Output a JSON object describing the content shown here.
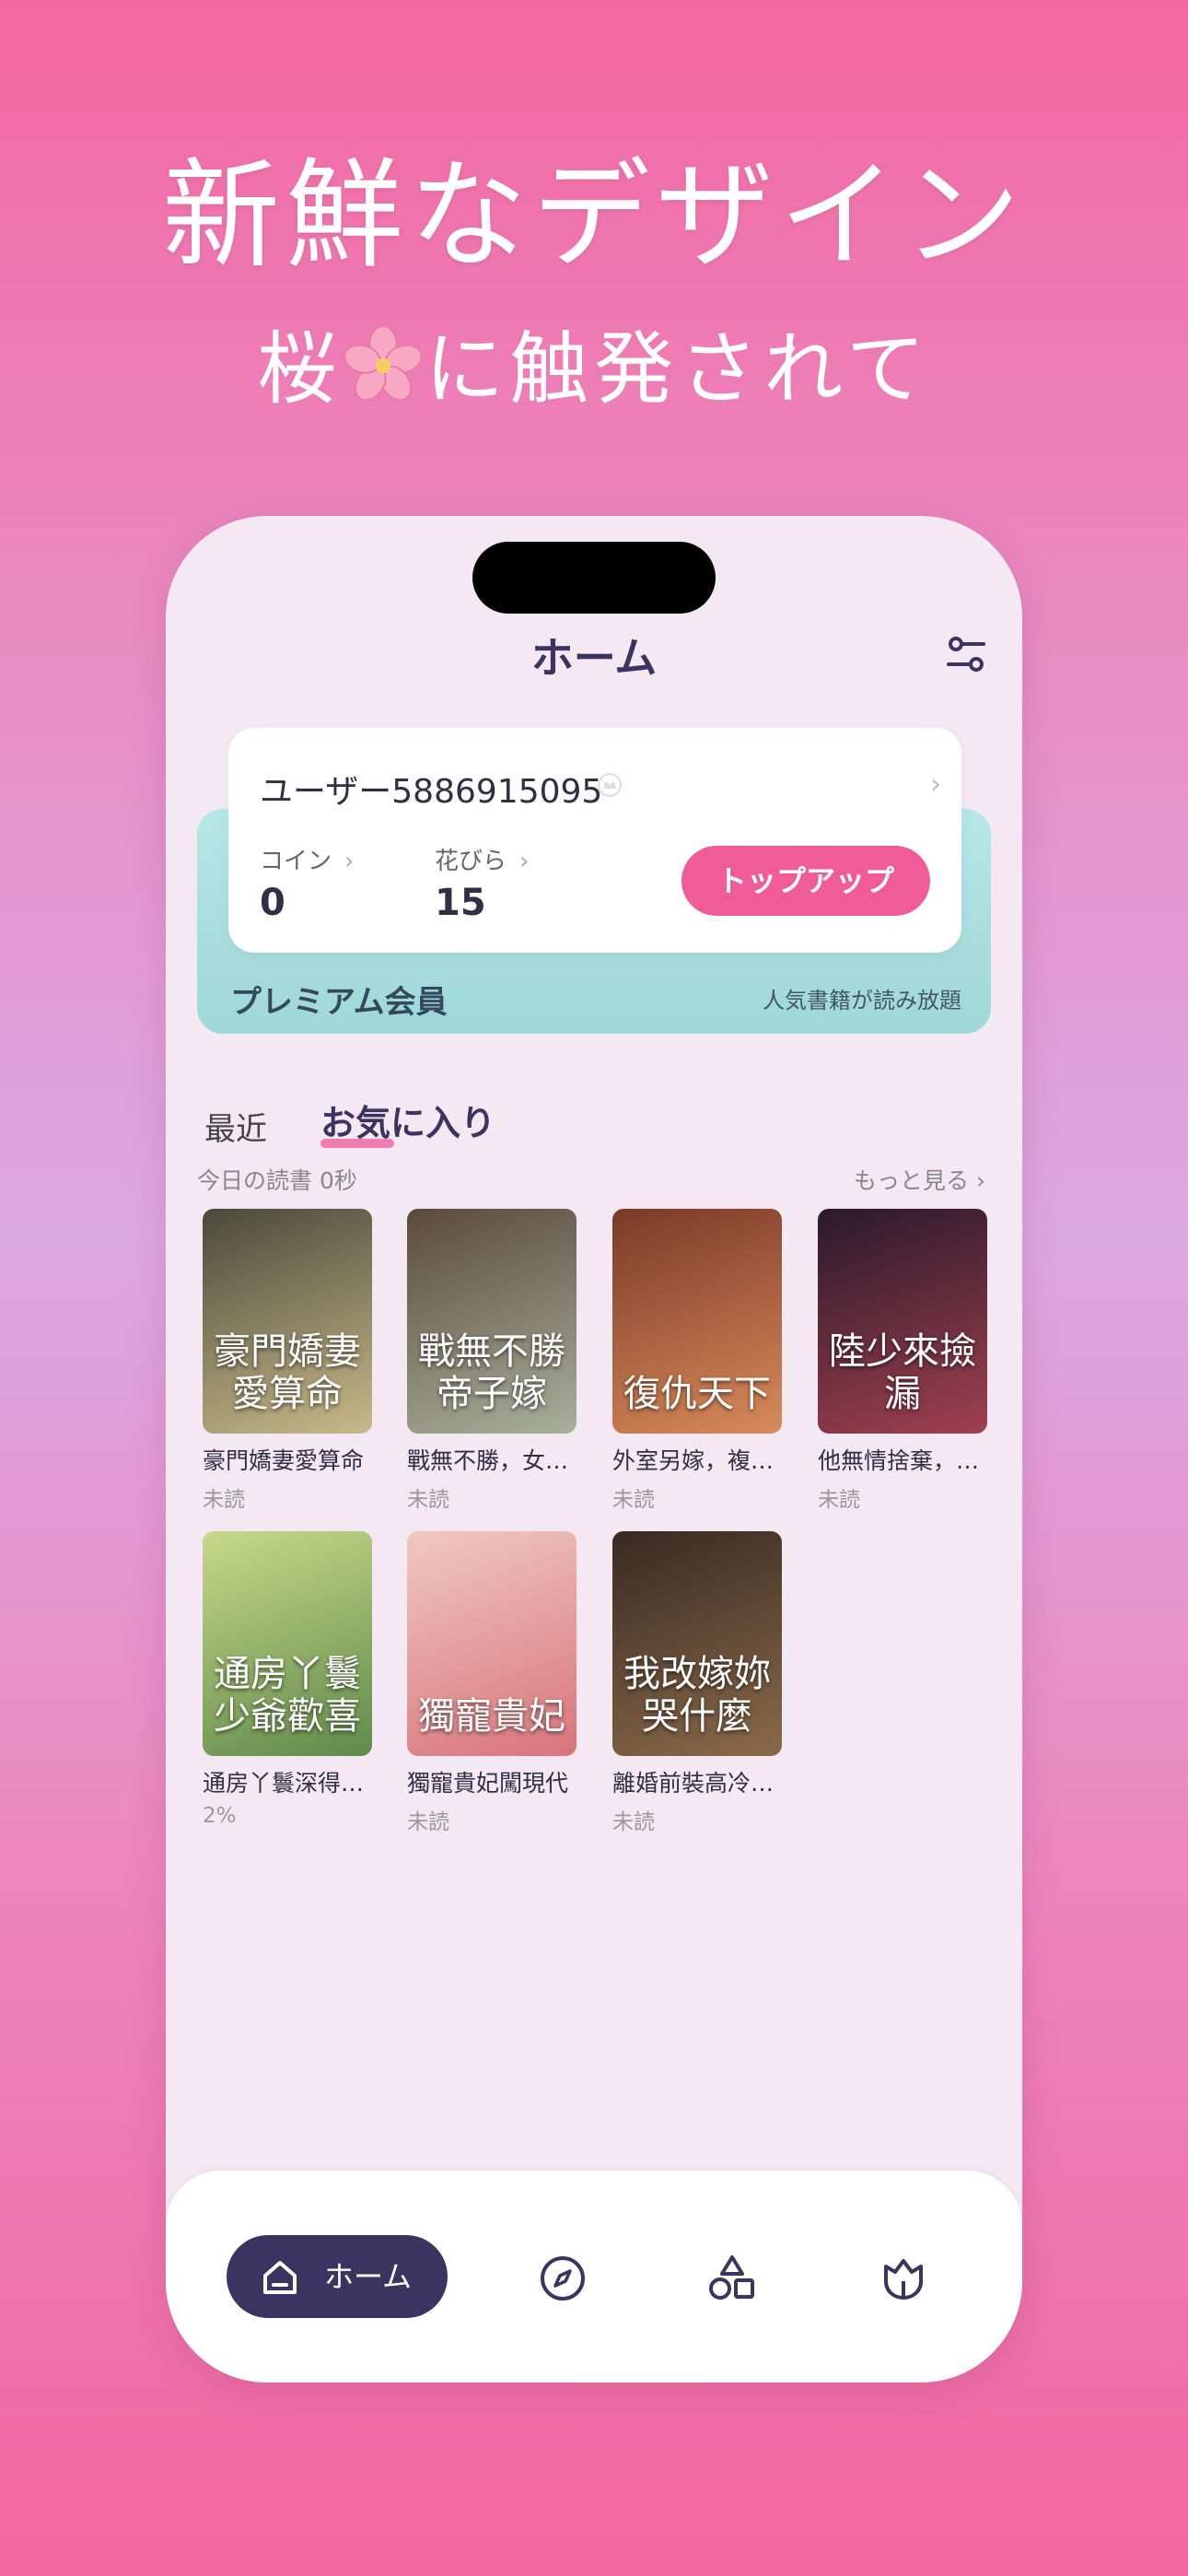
{
  "hero": {
    "title": "新鮮なデザイン",
    "subtitle_pre": "桜",
    "subtitle_post": "に触発されて"
  },
  "header": {
    "title": "ホーム"
  },
  "user_card": {
    "username": "ユーザー5886915095",
    "coin_label": "コイン",
    "coin_value": "0",
    "petal_label": "花びら",
    "petal_value": "15",
    "topup_label": "トップアップ"
  },
  "membership": {
    "label": "プレミアム会員",
    "perk": "人気書籍が読み放題"
  },
  "tabs": {
    "recent": "最近",
    "favorites": "お気に入り"
  },
  "reading": {
    "today": "今日の読書 0秒",
    "more": "もっと見る"
  },
  "books": [
    {
      "title": "豪門嬌妻愛算命",
      "status": "未読",
      "cover_text": "豪門嬌妻\n愛算命",
      "color1": "#4a4a3a",
      "color2": "#c9b98a"
    },
    {
      "title": "戰無不勝，女…",
      "status": "未読",
      "cover_text": "戰無不勝\n帝子嫁",
      "color1": "#5b4a3e",
      "color2": "#a8b09a"
    },
    {
      "title": "外室另嫁，複…",
      "status": "未読",
      "cover_text": "復仇天下",
      "color1": "#7a3a28",
      "color2": "#d98a5a"
    },
    {
      "title": "他無情捨棄，…",
      "status": "未読",
      "cover_text": "陸少來撿漏",
      "color1": "#2a1a2a",
      "color2": "#a04050"
    },
    {
      "title": "通房丫鬟深得…",
      "status": "2%",
      "cover_text": "通房丫鬟\n少爺歡喜",
      "color1": "#c8d88a",
      "color2": "#5f8a4a"
    },
    {
      "title": "獨寵貴妃闖現代",
      "status": "未読",
      "cover_text": "獨寵貴妃",
      "color1": "#f0c9c0",
      "color2": "#d8747a"
    },
    {
      "title": "離婚前裝高冷…",
      "status": "未読",
      "cover_text": "我改嫁妳\n哭什麼",
      "color1": "#3a2a22",
      "color2": "#8a6a4a"
    }
  ],
  "bottom_nav": {
    "home": "ホーム"
  },
  "colors": {
    "accent": "#ef5c97",
    "navy": "#3b3460",
    "mint": "#a9dfe0"
  }
}
